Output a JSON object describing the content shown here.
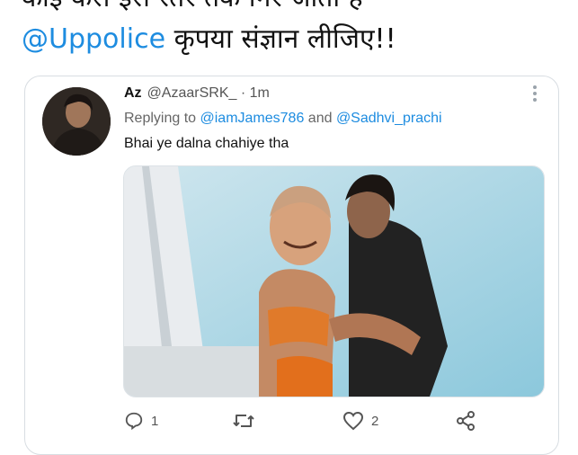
{
  "meme": {
    "top_text": "कोई कैसे इस स्तर तक गिर जाता है",
    "mention": "@Uppolice",
    "caption_rest": " कृपया संज्ञान लीजिए!!"
  },
  "tweet": {
    "display_name": "Az",
    "handle": "@AzaarSRK_",
    "separator": "·",
    "time": "1m",
    "replying_label": "Replying to",
    "reply_mention_1": "@iamJames786",
    "reply_and": " and ",
    "reply_mention_2": "@Sadhvi_prachi",
    "text": "Bhai ye dalna chahiye tha",
    "reply_count": "1",
    "retweet_count": "",
    "like_count": "2"
  },
  "colors": {
    "accent": "#1d8ce0",
    "muted": "#555555",
    "border": "#d8dde2"
  }
}
